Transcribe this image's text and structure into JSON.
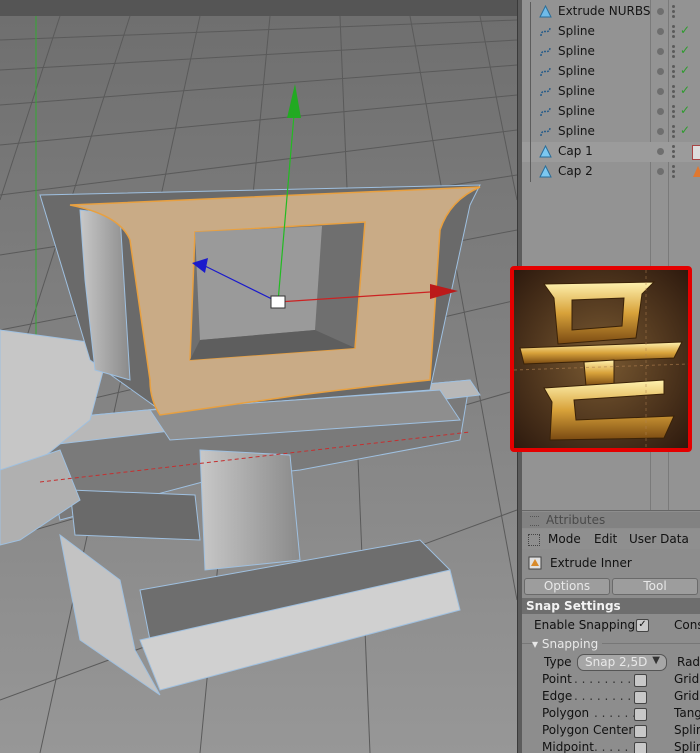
{
  "object_list": [
    {
      "name": "Extrude NURBS",
      "icon": "extrude-nurbs-icon",
      "tag": false
    },
    {
      "name": "Spline",
      "icon": "spline-icon",
      "tag": false
    },
    {
      "name": "Spline",
      "icon": "spline-icon",
      "tag": false
    },
    {
      "name": "Spline",
      "icon": "spline-icon",
      "tag": false
    },
    {
      "name": "Spline",
      "icon": "spline-icon",
      "tag": false
    },
    {
      "name": "Spline",
      "icon": "spline-icon",
      "tag": false
    },
    {
      "name": "Spline",
      "icon": "spline-icon",
      "tag": false
    },
    {
      "name": "Cap 1",
      "icon": "polygon-object-icon",
      "tag": true
    },
    {
      "name": "Cap 2",
      "icon": "polygon-object-icon",
      "tag": true
    }
  ],
  "check_mark": "✓",
  "attributes": {
    "title": "Attributes",
    "menu": [
      "Mode",
      "Edit",
      "User Data"
    ],
    "tool_name": "Extrude Inner",
    "tabs": [
      "Options",
      "Tool"
    ]
  },
  "snap": {
    "section_title": "Snap Settings",
    "enable_snapping_label": "Enable Snapping",
    "enable_snapping_checked": true,
    "right_label_cons": "Cons",
    "group_label": "Snapping",
    "type_label": "Type",
    "type_value": "Snap 2,5D",
    "type_right_label": "Rad",
    "options": [
      {
        "label": "Point",
        "dots": ". . . . . . . . .",
        "checked": false,
        "right": "Grid"
      },
      {
        "label": "Edge",
        "dots": ". . . . . . . . . .",
        "checked": false,
        "right": "Gridl"
      },
      {
        "label": "Polygon",
        "dots": ". . . . . . .",
        "checked": false,
        "right": "Tang"
      },
      {
        "label": "Polygon Center",
        "dots": "",
        "checked": false,
        "right": "Splin"
      },
      {
        "label": "Midpoint",
        "dots": ". . . . .",
        "checked": false,
        "right": "Splin"
      }
    ]
  },
  "colors": {
    "accent_red": "#e40000",
    "selection_orange": "#e8a040",
    "face_tan": "#c9ab86",
    "axis_green": "#22bb22",
    "axis_red": "#cc2222",
    "axis_blue": "#1a1acc"
  }
}
